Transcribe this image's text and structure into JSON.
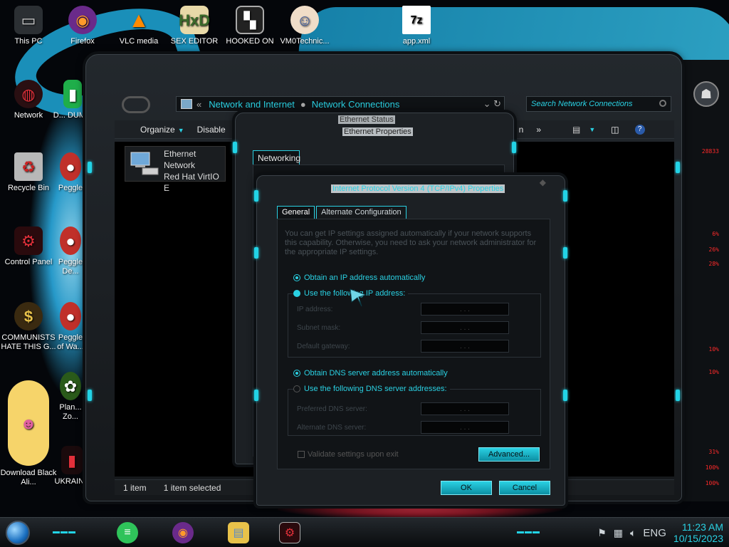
{
  "desktop_icons": [
    {
      "label": "This PC",
      "color": "#cfcfcf"
    },
    {
      "label": "Firefox",
      "color": "#ff7a1a"
    },
    {
      "label": "VLC media",
      "color": "#ff8a00"
    },
    {
      "label": "SEX EDITOR",
      "color": "#6aa84f"
    },
    {
      "label": "HOOKED ON",
      "color": "#ffffff"
    },
    {
      "label": "VM0Technic...",
      "color": "#f2c79c"
    },
    {
      "label": "app.xml",
      "color": "#ffffff"
    },
    {
      "label": "Network",
      "color": "#c9202b"
    },
    {
      "label": "D... DUM...",
      "color": "#2fc35a"
    },
    {
      "label": "Recycle Bin",
      "color": "#bfbfbf"
    },
    {
      "label": "Peggle",
      "color": "#d23a2a"
    },
    {
      "label": "Control Panel",
      "color": "#c7202b"
    },
    {
      "label": "Peggle De...",
      "color": "#d23a2a"
    },
    {
      "label": "COMMUNISTS HATE THIS G...",
      "color": "#c8a24a"
    },
    {
      "label": "Peggle of Wa...",
      "color": "#d23a2a"
    },
    {
      "label": "Plan... Zo...",
      "color": "#6fbf4f"
    },
    {
      "label": "Download Black Ali...",
      "color": "#f5d36a"
    },
    {
      "label": "UKRAINE",
      "color": "#c7202b"
    }
  ],
  "explorer": {
    "breadcrumb": [
      "Network and Internet",
      "Network Connections"
    ],
    "search_placeholder": "Search Network Connections",
    "toolbar": {
      "organize": "Organize",
      "disable": "Disable",
      "n": "n",
      "more": "»"
    },
    "item": {
      "line1": "Ethernet",
      "line2": "Network",
      "line3": "Red Hat VirtIO E"
    },
    "status_count": "1 item",
    "status_selected": "1 item selected"
  },
  "ethernet_props": {
    "title_back": "Ethernet Status",
    "title": "Ethernet Properties",
    "tab": "Networking"
  },
  "ipv4": {
    "title": "Internet Protocol Version 4 (TCP/IPv4) Properties",
    "tabs": [
      "General",
      "Alternate Configuration"
    ],
    "info": "You can get IP settings assigned automatically if your network supports this capability. Otherwise, you need to ask your network administrator for the appropriate IP settings.",
    "opt_auto_ip": "Obtain an IP address automatically",
    "opt_manual_ip": "Use the following IP address:",
    "ip_label": "IP address:",
    "mask_label": "Subnet mask:",
    "gateway_label": "Default gateway:",
    "opt_auto_dns": "Obtain DNS server address automatically",
    "opt_manual_dns": "Use the following DNS server addresses:",
    "pref_dns_label": "Preferred DNS server:",
    "alt_dns_label": "Alternate DNS server:",
    "validate": "Validate settings upon exit",
    "advanced": "Advanced...",
    "ok": "OK",
    "cancel": "Cancel",
    "dots": ". . ."
  },
  "gadget_values": [
    "28833",
    "6%",
    "26%",
    "28%",
    "10%",
    "10%",
    "31%",
    "100%",
    "100%"
  ],
  "taskbar": {
    "lang": "ENG",
    "time": "11:23 AM",
    "date": "10/15/2023"
  },
  "colors": {
    "accent": "#2ad1e3",
    "alert": "#ff2a2a"
  }
}
